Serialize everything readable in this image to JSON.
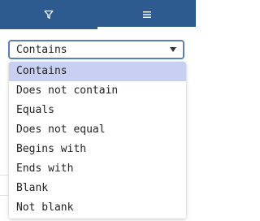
{
  "tabs": [
    {
      "name": "filter",
      "icon": "filter-icon",
      "active": true
    },
    {
      "name": "columns",
      "icon": "menu-icon",
      "active": false
    }
  ],
  "filter": {
    "selected_value": "Contains",
    "options": [
      "Contains",
      "Does not contain",
      "Equals",
      "Does not equal",
      "Begins with",
      "Ends with",
      "Blank",
      "Not blank"
    ]
  },
  "colors": {
    "tab_background": "#2d5a8f",
    "select_border": "#5a7fb3",
    "selected_option_background": "#c8cff0"
  }
}
